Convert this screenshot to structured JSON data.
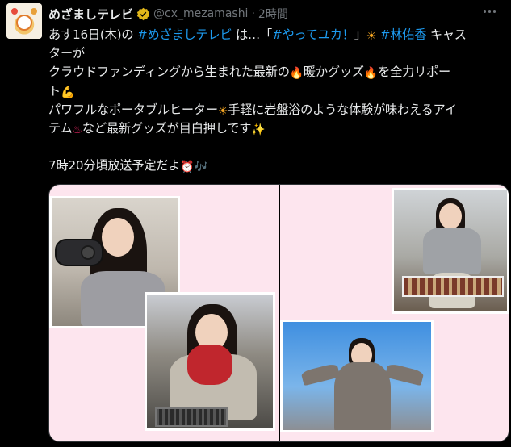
{
  "account": {
    "display_name": "めざましテレビ",
    "handle": "@cx_mezamashi",
    "separator": "·",
    "time_ago": "2時間"
  },
  "tweet": {
    "l1_a": "あす16日(木)の ",
    "l1_tag1": "#めざましテレビ",
    "l1_b": " は…「",
    "l1_tag2": "#やってユカ！",
    "l1_c": "」",
    "l1_emoji": "☀",
    "l1_tag3": "#林佑香",
    "l1_d": " キャス",
    "l2": "ターが",
    "l3_a": "クラウドファンディングから生まれた最新の",
    "l3_emoji1": "🔥",
    "l3_b": "暖かグッズ",
    "l3_emoji2": "🔥",
    "l3_c": "を全力リポー",
    "l4_a": "ト",
    "l4_emoji": "💪",
    "l5_a": "パワフルなポータブルヒーター",
    "l5_emoji": "☀",
    "l5_b": "手軽に岩盤浴のような体験が味わえるアイ",
    "l6_a": "テム",
    "l6_emoji1": "♨",
    "l6_b": "など最新グッズが目白押しです",
    "l6_emoji2": "✨",
    "l8_a": "7時20分頃放送予定だよ",
    "l8_emoji1": "⏰",
    "l8_emoji2": "🎶"
  },
  "icons": {
    "verified": "verified-badge-icon",
    "more": "more-options-icon"
  },
  "colors": {
    "background": "#000000",
    "text": "#e7e9ea",
    "muted": "#71767b",
    "link": "#1d9bf0",
    "verified_gold": "#e2b719",
    "media_pink": "#fde5ee"
  }
}
